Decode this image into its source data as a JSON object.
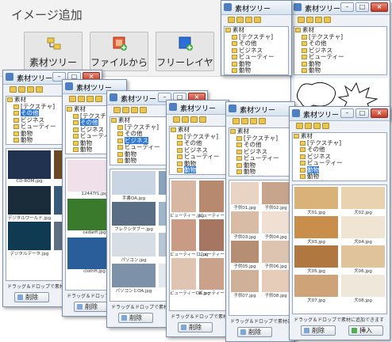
{
  "panel": {
    "title": "イメージ追加",
    "buttons": [
      {
        "label": "素材ツリー",
        "icon": "material-tree-icon"
      },
      {
        "label": "ファイルから",
        "icon": "image-file-add-icon"
      },
      {
        "label": "フリーレイヤ",
        "icon": "free-layer-add-icon"
      }
    ]
  },
  "window_title": "素材ツリー",
  "window_buttons": {
    "minimize": "–",
    "maximize": "□",
    "close": "×"
  },
  "tree_root": "素材",
  "tree_items": [
    "[テクスチャ]",
    "その他",
    "ビジネス",
    "ビューティー",
    "動物",
    "動物",
    "飲食(料理)",
    "子供&家族"
  ],
  "hint": "ドラッグ＆ドロップで素材に追加できます",
  "delete_label": "削除",
  "insert_label": "挿入",
  "windows": [
    {
      "id": "w1",
      "selected": 1,
      "captions": [
        "CD-ROM.jpg",
        "デバイス.jpg",
        "デジタルワールド.jpg",
        "データ.jpg",
        "デジタルデータ.jpg",
        "データ.jpg"
      ],
      "palette": [
        "#20324f",
        "#6b4a2a",
        "#1a2c3a",
        "#3a5a7a",
        "#0f3a52",
        "#5f6f7f",
        "#2a4c6c",
        "#4a6a8a"
      ]
    },
    {
      "id": "w2",
      "selected": 1,
      "captions": [
        "12447f1.jpg",
        "cedarfi.jpg",
        "clothH.jpg"
      ],
      "palette": [
        "#f0e0ea",
        "#3a7a2c",
        "#2a5e9a",
        "#caa07a"
      ]
    },
    {
      "id": "w3",
      "selected": 2,
      "captions": [
        "手書OA.jpg",
        "",
        "フレクシタブー.jpg",
        "",
        "パソコン.jpg",
        "",
        "パソコンとOA.jpg",
        ""
      ],
      "palette": [
        "#c9d5e2",
        "#8aa2bb",
        "#5a6f86",
        "#9fb5c9",
        "#d6dde5",
        "#b9c6d3",
        "#7d92a8",
        "#e4e9ee"
      ]
    },
    {
      "id": "w4",
      "selected": 5,
      "captions": [
        "ビューティー.jpg",
        "ビューティー",
        "ビューティーと.jpg",
        "ビューティー",
        "ビューティーOA.jpg",
        "ビューティー"
      ],
      "palette": [
        "#d8b7a2",
        "#b78a6f",
        "#c99b84",
        "#a67662",
        "#e0c4b2",
        "#caa18a"
      ]
    },
    {
      "id": "w5",
      "selected": 7,
      "captions": [
        "子供01.jpg",
        "子供02.jpg",
        "子供03.jpg",
        "子供04.jpg",
        "子供05.jpg",
        "子供06.jpg",
        "子供07.jpg",
        "子供08.jpg"
      ],
      "palette": [
        "#e9d3c2",
        "#c7a48c",
        "#d8bca6",
        "#f0e0d3",
        "#b68e74",
        "#dcc4b0",
        "#cfb19a",
        "#e5cdb9"
      ]
    },
    {
      "id": "w6",
      "selected": 4,
      "captions": [
        "犬01.jpg",
        "犬02.jpg",
        "犬03.jpg",
        "犬04.jpg",
        "犬05.jpg",
        "犬06.jpg",
        "犬07.jpg",
        "犬08.jpg"
      ],
      "palette": [
        "#d9b27a",
        "#e8d2b0",
        "#c98e4c",
        "#f0e4d2",
        "#b07840",
        "#e0c39a",
        "#cda377",
        "#efe7da"
      ]
    },
    {
      "id": "w7",
      "selected": 7,
      "captions": [],
      "palette": []
    }
  ],
  "colors": {
    "selection": "#2f7ad6",
    "accent": "#4f7fbf"
  }
}
